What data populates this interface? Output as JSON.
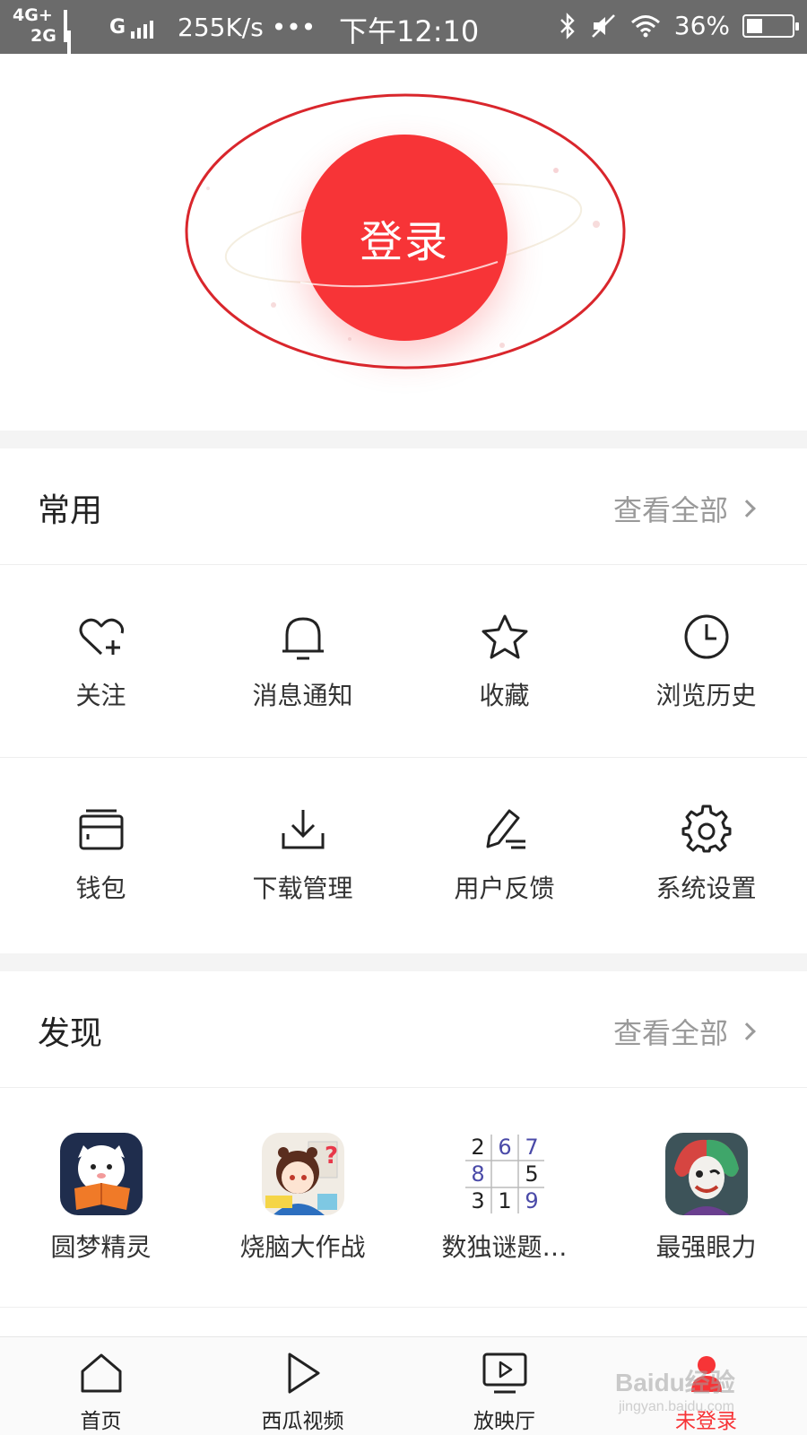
{
  "status_bar": {
    "net_line1": "4G+",
    "net_line2": "2G",
    "g_label": "G",
    "speed": "255K/s •••",
    "time": "下午12:10",
    "battery": "36%",
    "battery_level": 0.36
  },
  "hero": {
    "login_label": "登录",
    "accent_color": "#f73437",
    "annotation_color": "#d9262c"
  },
  "common": {
    "title": "常用",
    "view_all": "查看全部",
    "items": [
      {
        "label": "关注",
        "icon": "heart-plus-icon"
      },
      {
        "label": "消息通知",
        "icon": "bell-icon"
      },
      {
        "label": "收藏",
        "icon": "star-icon"
      },
      {
        "label": "浏览历史",
        "icon": "clock-icon"
      },
      {
        "label": "钱包",
        "icon": "wallet-icon"
      },
      {
        "label": "下载管理",
        "icon": "download-icon"
      },
      {
        "label": "用户反馈",
        "icon": "pen-icon"
      },
      {
        "label": "系统设置",
        "icon": "gear-icon"
      }
    ]
  },
  "discover": {
    "title": "发现",
    "view_all": "查看全部",
    "apps": [
      {
        "label": "圆梦精灵",
        "icon": "dream-sprite-app-icon"
      },
      {
        "label": "烧脑大作战",
        "icon": "brain-battle-app-icon"
      },
      {
        "label": "数独谜题…",
        "icon": "sudoku-app-icon"
      },
      {
        "label": "最强眼力",
        "icon": "sharp-eye-app-icon"
      }
    ],
    "sudoku_digits": [
      "2",
      "6",
      "7",
      "8",
      "",
      "5",
      "3",
      "1",
      "9"
    ]
  },
  "bottom_nav": {
    "items": [
      {
        "label": "首页",
        "icon": "home-icon"
      },
      {
        "label": "西瓜视频",
        "icon": "play-icon"
      },
      {
        "label": "放映厅",
        "icon": "tv-play-icon"
      },
      {
        "label": "未登录",
        "icon": "user-icon"
      }
    ],
    "watermark": "Baidu经验",
    "watermark_sub": "jingyan.baidu.com"
  }
}
